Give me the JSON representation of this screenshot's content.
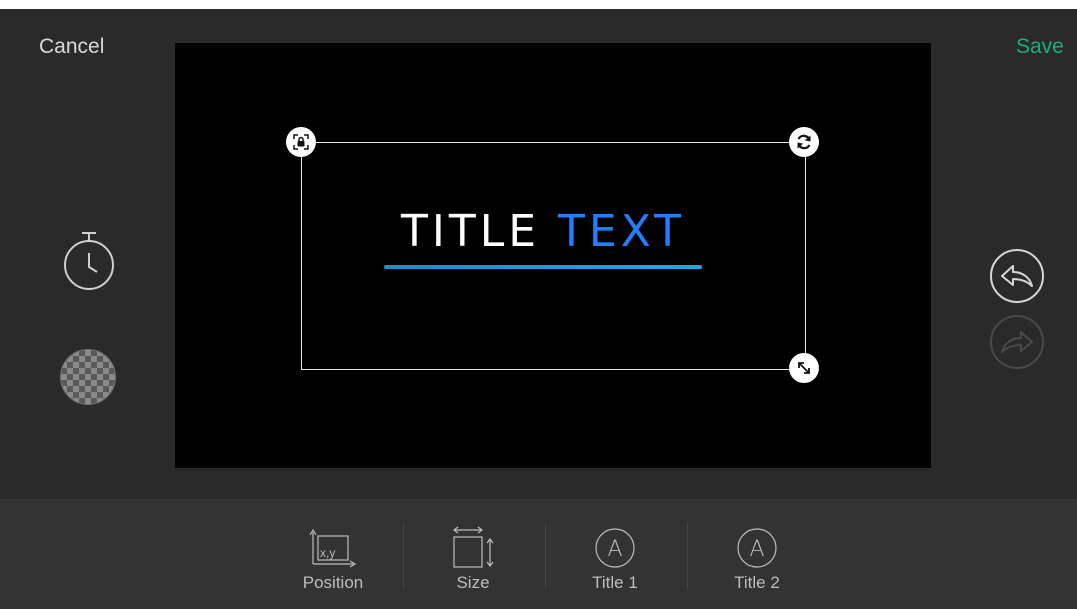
{
  "header": {
    "cancel_label": "Cancel",
    "save_label": "Save",
    "save_color": "#19b07e"
  },
  "canvas": {
    "title_part1": "TITLE",
    "title_part2": "TEXT",
    "title_part2_color": "#1f7fff",
    "underline_color": "#1aa9f0",
    "handles": [
      "lock-icon",
      "rotate-icon",
      "resize-icon"
    ]
  },
  "left_panel": {
    "icons": [
      "timer-icon",
      "transparency-icon"
    ]
  },
  "right_panel": {
    "icons": [
      "undo-icon",
      "redo-icon"
    ],
    "redo_enabled": false
  },
  "toolbar": {
    "items": [
      {
        "label": "Position",
        "icon": "position-icon",
        "icon_text": "x,y"
      },
      {
        "label": "Size",
        "icon": "size-icon"
      },
      {
        "label": "Title 1",
        "icon": "font-a-icon",
        "icon_text": "A"
      },
      {
        "label": "Title 2",
        "icon": "font-a-icon",
        "icon_text": "A"
      }
    ]
  }
}
